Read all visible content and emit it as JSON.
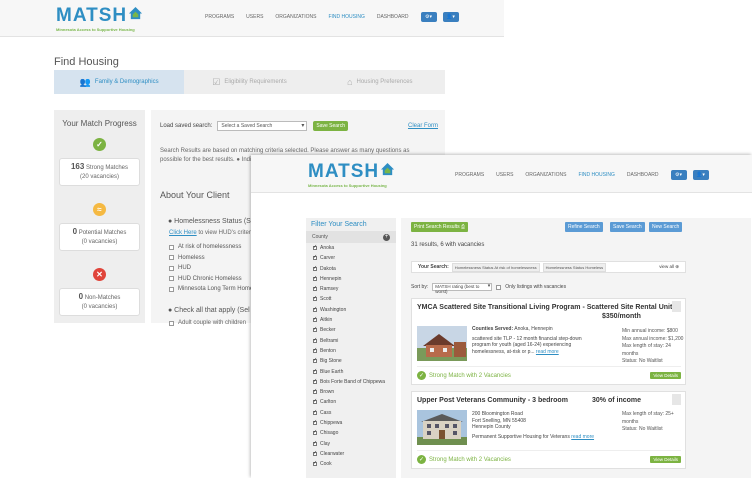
{
  "brand": {
    "logo_text": "MATSH",
    "tagline": "Minnesota Access to Supportive Housing"
  },
  "nav": {
    "items": [
      "PROGRAMS",
      "USERS",
      "ORGANIZATIONS",
      "FIND HOUSING",
      "DASHBOARD"
    ],
    "active": "FIND HOUSING",
    "gear_icon": "gear-icon",
    "user_icon": "user-icon"
  },
  "page": {
    "title": "Find Housing",
    "steps": [
      "Family & Demographics",
      "Eligibility Requirements",
      "Housing Preferences"
    ]
  },
  "progress": {
    "title": "Your Match Progress",
    "strong": {
      "count": "163",
      "label": "Strong Matches",
      "vacancies": "(20 vacancies)"
    },
    "potential": {
      "count": "0",
      "label": "Potential Matches",
      "vacancies": "(0 vacancies)"
    },
    "non": {
      "count": "0",
      "label": "Non-Matches",
      "vacancies": "(0 vacancies)"
    }
  },
  "search_form": {
    "load_label": "Load saved search:",
    "select_placeholder": "Select a Saved Search",
    "save_button": "Save Search",
    "clear_link": "Clear Form",
    "description": "Search Results are based on matching criteria selected. Please answer as many questions as possible for the best results.",
    "desc_more": "● Indicates required questions",
    "about_title": "About Your Client",
    "homeless_title": "● Homelessness Status (Se",
    "hud_link": "Click Here",
    "hud_link_rest": " to view HUD's criter",
    "homeless_options": [
      "At risk of homelessness",
      "Homeless",
      "HUD",
      "HUD Chronic Homeless",
      "Minnesota Long Term Home"
    ],
    "check_all": "● Check all that apply (Sel",
    "adult_option": "Adult couple with children"
  },
  "filter": {
    "title": "Filter Your Search",
    "county_header": "County",
    "counties": [
      "Anoka",
      "Carver",
      "Dakota",
      "Hennepin",
      "Ramsey",
      "Scott",
      "Washington",
      "Aitkin",
      "Becker",
      "Beltrami",
      "Benton",
      "Big Stone",
      "Blue Earth",
      "Bois Forte Band of Chippewa",
      "Brown",
      "Carlton",
      "Cass",
      "Chippewa",
      "Chisago",
      "Clay",
      "Clearwater",
      "Cook"
    ]
  },
  "results": {
    "print_button": "Print Search Results",
    "refine_button": "Refine Search",
    "save_button": "Save Search",
    "new_button": "New Search",
    "count_text": "31 results, 6 with vacancies",
    "your_search_label": "Your Search:",
    "tags": [
      "Homelessness Status At risk of homelessness",
      "Homelessness Status Homeless"
    ],
    "view_all": "view all",
    "sort_label": "Sort by:",
    "sort_value": "MATSH rating (best to worst)",
    "only_vacancies": "Only listings with vacancies",
    "listings": [
      {
        "title": "YMCA Scattered Site Transitional Living Program - Scattered Site Rental Units",
        "price": "$350/month",
        "counties_label": "Counties Served:",
        "counties": "Anoka, Hennepin",
        "description": "scattered site TLP - 12 month financial step-down program for youth (aged 16-24) experiencing homelessness, at-risk or p...",
        "read_more": "read more",
        "meta": [
          "Min annual income: $800",
          "Max annual income: $1,200",
          "Max length of stay: 24 months",
          "Status: No Waitlist"
        ],
        "match": "Strong Match with 2 Vacancies",
        "details": "View Details"
      },
      {
        "title": "Upper Post Veterans Community - 3 bedroom",
        "price": "30% of income",
        "address": [
          "200 Bloomington Road",
          "Fort Snelling, MN 55408",
          "Hennepin County"
        ],
        "description": "Permanent Supportive Housing for Veterans",
        "read_more": "read more",
        "meta": [
          "Max length of stay: 25+ months",
          "Status: No Waitlist"
        ],
        "match": "Strong Match with 2 Vacancies",
        "details": "View Details"
      }
    ]
  },
  "colors": {
    "brand_blue": "#2e8ec3",
    "brand_green": "#7cb342",
    "danger_red": "#e0443a",
    "potential_orange": "#f5b942",
    "nav_button": "#3a7fbf"
  }
}
